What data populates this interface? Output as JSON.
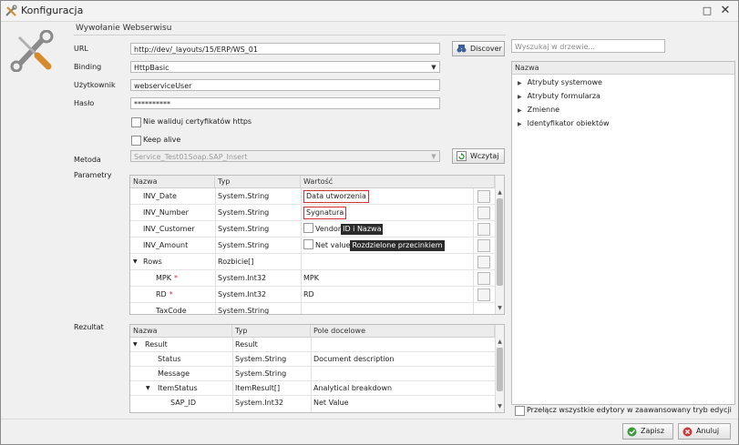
{
  "window": {
    "title": "Konfiguracja",
    "maximize": "□",
    "close": "✕"
  },
  "group_title": "Wywołanie Webserwisu",
  "form": {
    "url_label": "URL",
    "url_value": "http://dev/_layouts/15/ERP/WS_01",
    "binding_label": "Binding",
    "binding_value": "HttpBasic",
    "user_label": "Użytkownik",
    "user_value": "webserviceUser",
    "password_label": "Hasło",
    "password_value": "**********",
    "ssl_checkbox_label": "Nie waliduj certyfikatów https",
    "keepalive_checkbox_label": "Keep alive",
    "method_label": "Metoda",
    "method_value": "Service_Test01Soap.SAP_Insert",
    "discover_button": "Discover",
    "load_button": "Wczytaj",
    "params_label": "Parametry",
    "result_label": "Rezultat"
  },
  "params_grid": {
    "headers": [
      "Nazwa",
      "Typ",
      "Wartość"
    ],
    "rows": [
      {
        "name": "INV_Date",
        "type": "System.String",
        "value": "Data utworzenia"
      },
      {
        "name": "INV_Number",
        "type": "System.String",
        "value": "Sygnatura"
      },
      {
        "name": "INV_Customer",
        "type": "System.String",
        "value_field": "Vendor",
        "value_tag": "ID i Nazwa"
      },
      {
        "name": "INV_Amount",
        "type": "System.String",
        "value_field": "Net value",
        "value_tag": "Rozdzielone przecinkiem"
      },
      {
        "name": "Rows",
        "type": "Rozbicie[]",
        "value": ""
      },
      {
        "name": "MPK",
        "type": "System.Int32",
        "value": "MPK",
        "required": "*"
      },
      {
        "name": "RD",
        "type": "System.Int32",
        "value": "RD",
        "required": "*"
      },
      {
        "name": "TaxCode",
        "type": "System.String",
        "value": ""
      }
    ]
  },
  "result_grid": {
    "headers": [
      "Nazwa",
      "Typ",
      "Pole docelowe"
    ],
    "rows": [
      {
        "name": "Result",
        "type": "Result",
        "target": ""
      },
      {
        "name": "Status",
        "type": "System.String",
        "target": "Document description"
      },
      {
        "name": "Message",
        "type": "System.String",
        "target": ""
      },
      {
        "name": "ItemStatus",
        "type": "ItemResult[]",
        "target": "Analytical breakdown"
      },
      {
        "name": "SAP_ID",
        "type": "System.Int32",
        "target": "Net Value"
      }
    ]
  },
  "tree": {
    "search_placeholder": "Wyszukaj w drzewie...",
    "header": "Nazwa",
    "items": [
      "Atrybuty systemowe",
      "Atrybuty formularza",
      "Zmienne",
      "Identyfikator obiektów"
    ],
    "advanced_checkbox_label": "Przełącz wszystkie edytory w zaawansowany tryb edycji"
  },
  "footer": {
    "save_button": "Zapisz",
    "cancel_button": "Anuluj"
  },
  "colors": {
    "required": "#d62f3a",
    "tag_bg": "#2b2b2b",
    "save_green": "#3c9a3c",
    "cancel_red": "#c83b3b"
  }
}
